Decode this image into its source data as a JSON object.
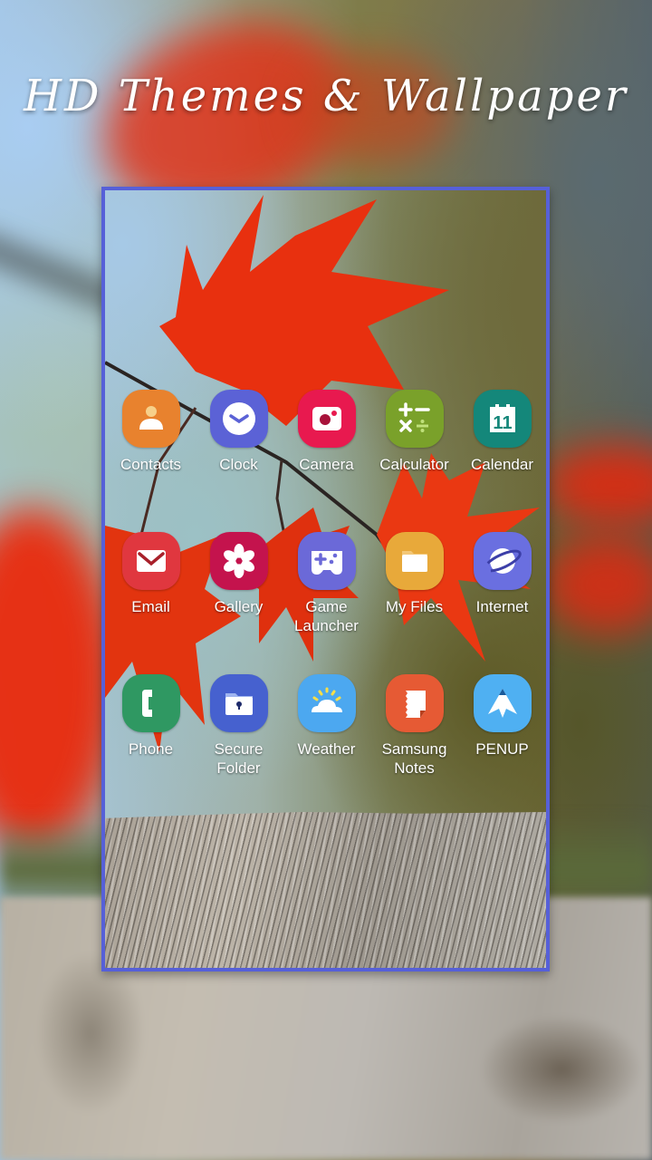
{
  "headline": "HD Themes & Wallpaper",
  "colors": {
    "frame_border": "#5660d8",
    "label_text": "#ffffff"
  },
  "apps": [
    {
      "label": "Contacts",
      "icon": "contacts-icon",
      "color": "#e8822e"
    },
    {
      "label": "Clock",
      "icon": "clock-icon",
      "color": "#5b62d6"
    },
    {
      "label": "Camera",
      "icon": "camera-icon",
      "color": "#e8194f"
    },
    {
      "label": "Calculator",
      "icon": "calculator-icon",
      "color": "#7aa12a"
    },
    {
      "label": "Calendar",
      "icon": "calendar-icon",
      "color": "#14877a",
      "day": "11"
    },
    {
      "label": "Email",
      "icon": "email-icon",
      "color": "#e0373f"
    },
    {
      "label": "Gallery",
      "icon": "gallery-icon",
      "color": "#c4134d"
    },
    {
      "label": "Game\nLauncher",
      "icon": "game-launcher-icon",
      "color": "#6b69d8"
    },
    {
      "label": "My Files",
      "icon": "my-files-icon",
      "color": "#e8a93a"
    },
    {
      "label": "Internet",
      "icon": "internet-icon",
      "color": "#6a6fe0"
    },
    {
      "label": "Phone",
      "icon": "phone-icon",
      "color": "#2f9862"
    },
    {
      "label": "Secure\nFolder",
      "icon": "secure-folder-icon",
      "color": "#4661cf"
    },
    {
      "label": "Weather",
      "icon": "weather-icon",
      "color": "#4ca8f0"
    },
    {
      "label": "Samsung\nNotes",
      "icon": "samsung-notes-icon",
      "color": "#e65a34"
    },
    {
      "label": "PENUP",
      "icon": "penup-icon",
      "color": "#4fb0f2"
    }
  ]
}
